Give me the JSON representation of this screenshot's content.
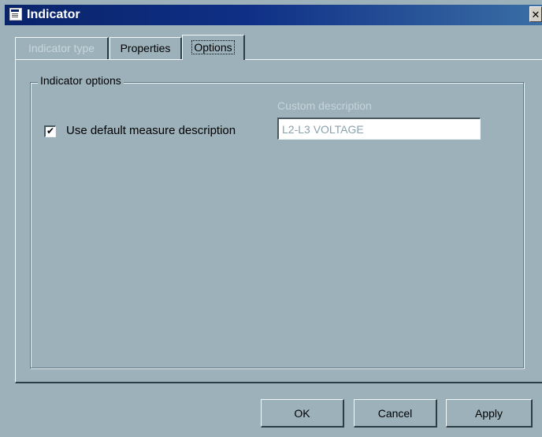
{
  "window": {
    "title": "Indicator",
    "icon": "window-icon",
    "close_glyph": "✕"
  },
  "tabs": [
    {
      "label": "Indicator type",
      "state": "disabled"
    },
    {
      "label": "Properties",
      "state": "normal"
    },
    {
      "label": "Options",
      "state": "active"
    }
  ],
  "options": {
    "group_title": "Indicator options",
    "use_default": {
      "label": "Use default measure description",
      "checked": true,
      "check_glyph": "✔"
    },
    "custom_description": {
      "label": "Custom description",
      "value": "L2-L3 VOLTAGE",
      "disabled": true
    }
  },
  "buttons": {
    "ok": "OK",
    "cancel": "Cancel",
    "apply": "Apply"
  },
  "colors": {
    "background": "#9db1bb",
    "title_bar": "#0a246a",
    "disabled_text": "#c6d4da"
  }
}
